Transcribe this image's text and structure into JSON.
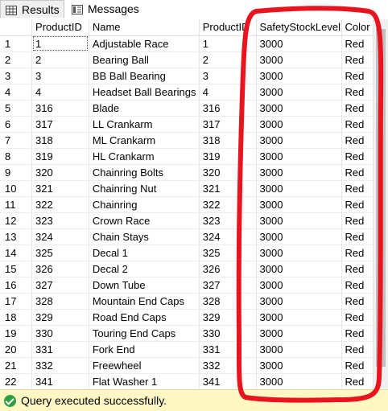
{
  "tabs": {
    "results": "Results",
    "messages": "Messages"
  },
  "columns": [
    "ProductID",
    "Name",
    "ProductID",
    "SafetyStockLevel",
    "Color"
  ],
  "rows": [
    {
      "n": "1",
      "id": "1",
      "name": "Adjustable Race",
      "pid": "1",
      "ssl": "3000",
      "color": "Red"
    },
    {
      "n": "2",
      "id": "2",
      "name": "Bearing Ball",
      "pid": "2",
      "ssl": "3000",
      "color": "Red"
    },
    {
      "n": "3",
      "id": "3",
      "name": "BB Ball Bearing",
      "pid": "3",
      "ssl": "3000",
      "color": "Red"
    },
    {
      "n": "4",
      "id": "4",
      "name": "Headset Ball Bearings",
      "pid": "4",
      "ssl": "3000",
      "color": "Red"
    },
    {
      "n": "5",
      "id": "316",
      "name": "Blade",
      "pid": "316",
      "ssl": "3000",
      "color": "Red"
    },
    {
      "n": "6",
      "id": "317",
      "name": "LL Crankarm",
      "pid": "317",
      "ssl": "3000",
      "color": "Red"
    },
    {
      "n": "7",
      "id": "318",
      "name": "ML Crankarm",
      "pid": "318",
      "ssl": "3000",
      "color": "Red"
    },
    {
      "n": "8",
      "id": "319",
      "name": "HL Crankarm",
      "pid": "319",
      "ssl": "3000",
      "color": "Red"
    },
    {
      "n": "9",
      "id": "320",
      "name": "Chainring Bolts",
      "pid": "320",
      "ssl": "3000",
      "color": "Red"
    },
    {
      "n": "10",
      "id": "321",
      "name": "Chainring Nut",
      "pid": "321",
      "ssl": "3000",
      "color": "Red"
    },
    {
      "n": "11",
      "id": "322",
      "name": "Chainring",
      "pid": "322",
      "ssl": "3000",
      "color": "Red"
    },
    {
      "n": "12",
      "id": "323",
      "name": "Crown Race",
      "pid": "323",
      "ssl": "3000",
      "color": "Red"
    },
    {
      "n": "13",
      "id": "324",
      "name": "Chain Stays",
      "pid": "324",
      "ssl": "3000",
      "color": "Red"
    },
    {
      "n": "14",
      "id": "325",
      "name": "Decal 1",
      "pid": "325",
      "ssl": "3000",
      "color": "Red"
    },
    {
      "n": "15",
      "id": "326",
      "name": "Decal 2",
      "pid": "326",
      "ssl": "3000",
      "color": "Red"
    },
    {
      "n": "16",
      "id": "327",
      "name": "Down Tube",
      "pid": "327",
      "ssl": "3000",
      "color": "Red"
    },
    {
      "n": "17",
      "id": "328",
      "name": "Mountain End Caps",
      "pid": "328",
      "ssl": "3000",
      "color": "Red"
    },
    {
      "n": "18",
      "id": "329",
      "name": "Road End Caps",
      "pid": "329",
      "ssl": "3000",
      "color": "Red"
    },
    {
      "n": "19",
      "id": "330",
      "name": "Touring End Caps",
      "pid": "330",
      "ssl": "3000",
      "color": "Red"
    },
    {
      "n": "20",
      "id": "331",
      "name": "Fork End",
      "pid": "331",
      "ssl": "3000",
      "color": "Red"
    },
    {
      "n": "21",
      "id": "332",
      "name": "Freewheel",
      "pid": "332",
      "ssl": "3000",
      "color": "Red"
    },
    {
      "n": "22",
      "id": "341",
      "name": "Flat Washer 1",
      "pid": "341",
      "ssl": "3000",
      "color": "Red"
    }
  ],
  "status": {
    "text": "Query executed successfully.",
    "icon": "check-circle-icon",
    "background": "#fff8c5"
  },
  "annotation_color": "#e8141f"
}
